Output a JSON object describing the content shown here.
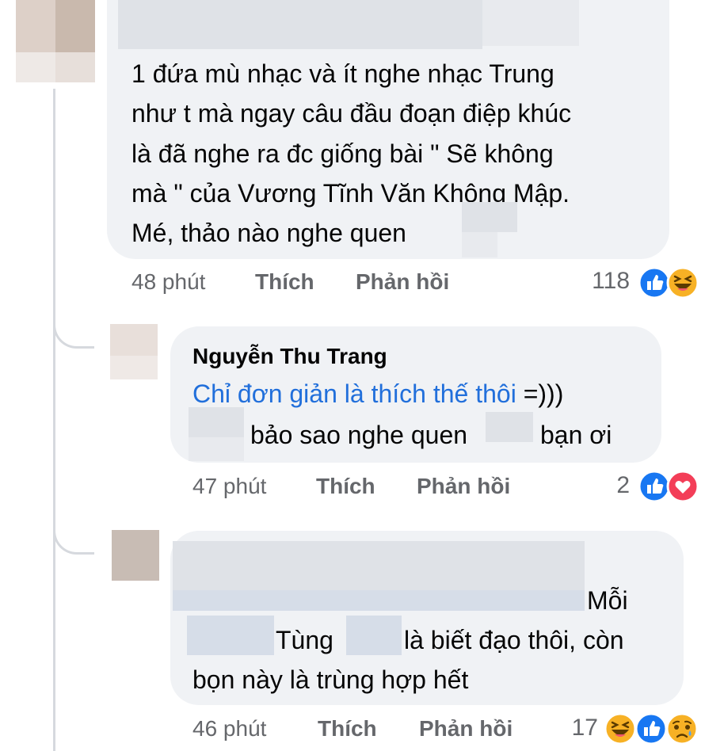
{
  "comments": [
    {
      "body_lines": [
        "1 đứa mù nhạc và ít nghe nhạc Trung",
        "như t mà ngay câu đầu đoạn điệp khúc",
        "là đã nghe ra đc giống bài \" Sẽ không",
        "mà \" của Vương Tĩnh Văn Không Mập.",
        "Mé, thảo nào nghe quen"
      ],
      "time": "48 phút",
      "like": "Thích",
      "reply": "Phản hồi",
      "reaction_count": "118",
      "reactions": [
        "like-icon",
        "haha-icon"
      ]
    },
    {
      "author": "Nguyễn Thu Trang",
      "link_text": "Chỉ đơn giản là thích thế thôi",
      "link_suffix": " =)))",
      "line2a": "bảo sao nghe quen",
      "line2b": "bạn ơi",
      "time": "47 phút",
      "like": "Thích",
      "reply": "Phản hồi",
      "reaction_count": "2",
      "reactions": [
        "like-icon",
        "love-icon"
      ]
    },
    {
      "line1": "Mỗi",
      "line2a": "Tùng",
      "line2b": "là biết đạo thôi, còn",
      "line3": "bọn này là trùng hợp hết",
      "time": "46 phút",
      "like": "Thích",
      "reply": "Phản hồi",
      "reaction_count": "17",
      "reactions": [
        "haha-icon",
        "like-icon",
        "sad-icon"
      ]
    }
  ],
  "colors": {
    "bubble": "#f0f2f5",
    "link": "#216fdb",
    "meta": "#65676b",
    "like": "#1877f2",
    "love": "#f33e58",
    "haha": "#f7b125"
  }
}
